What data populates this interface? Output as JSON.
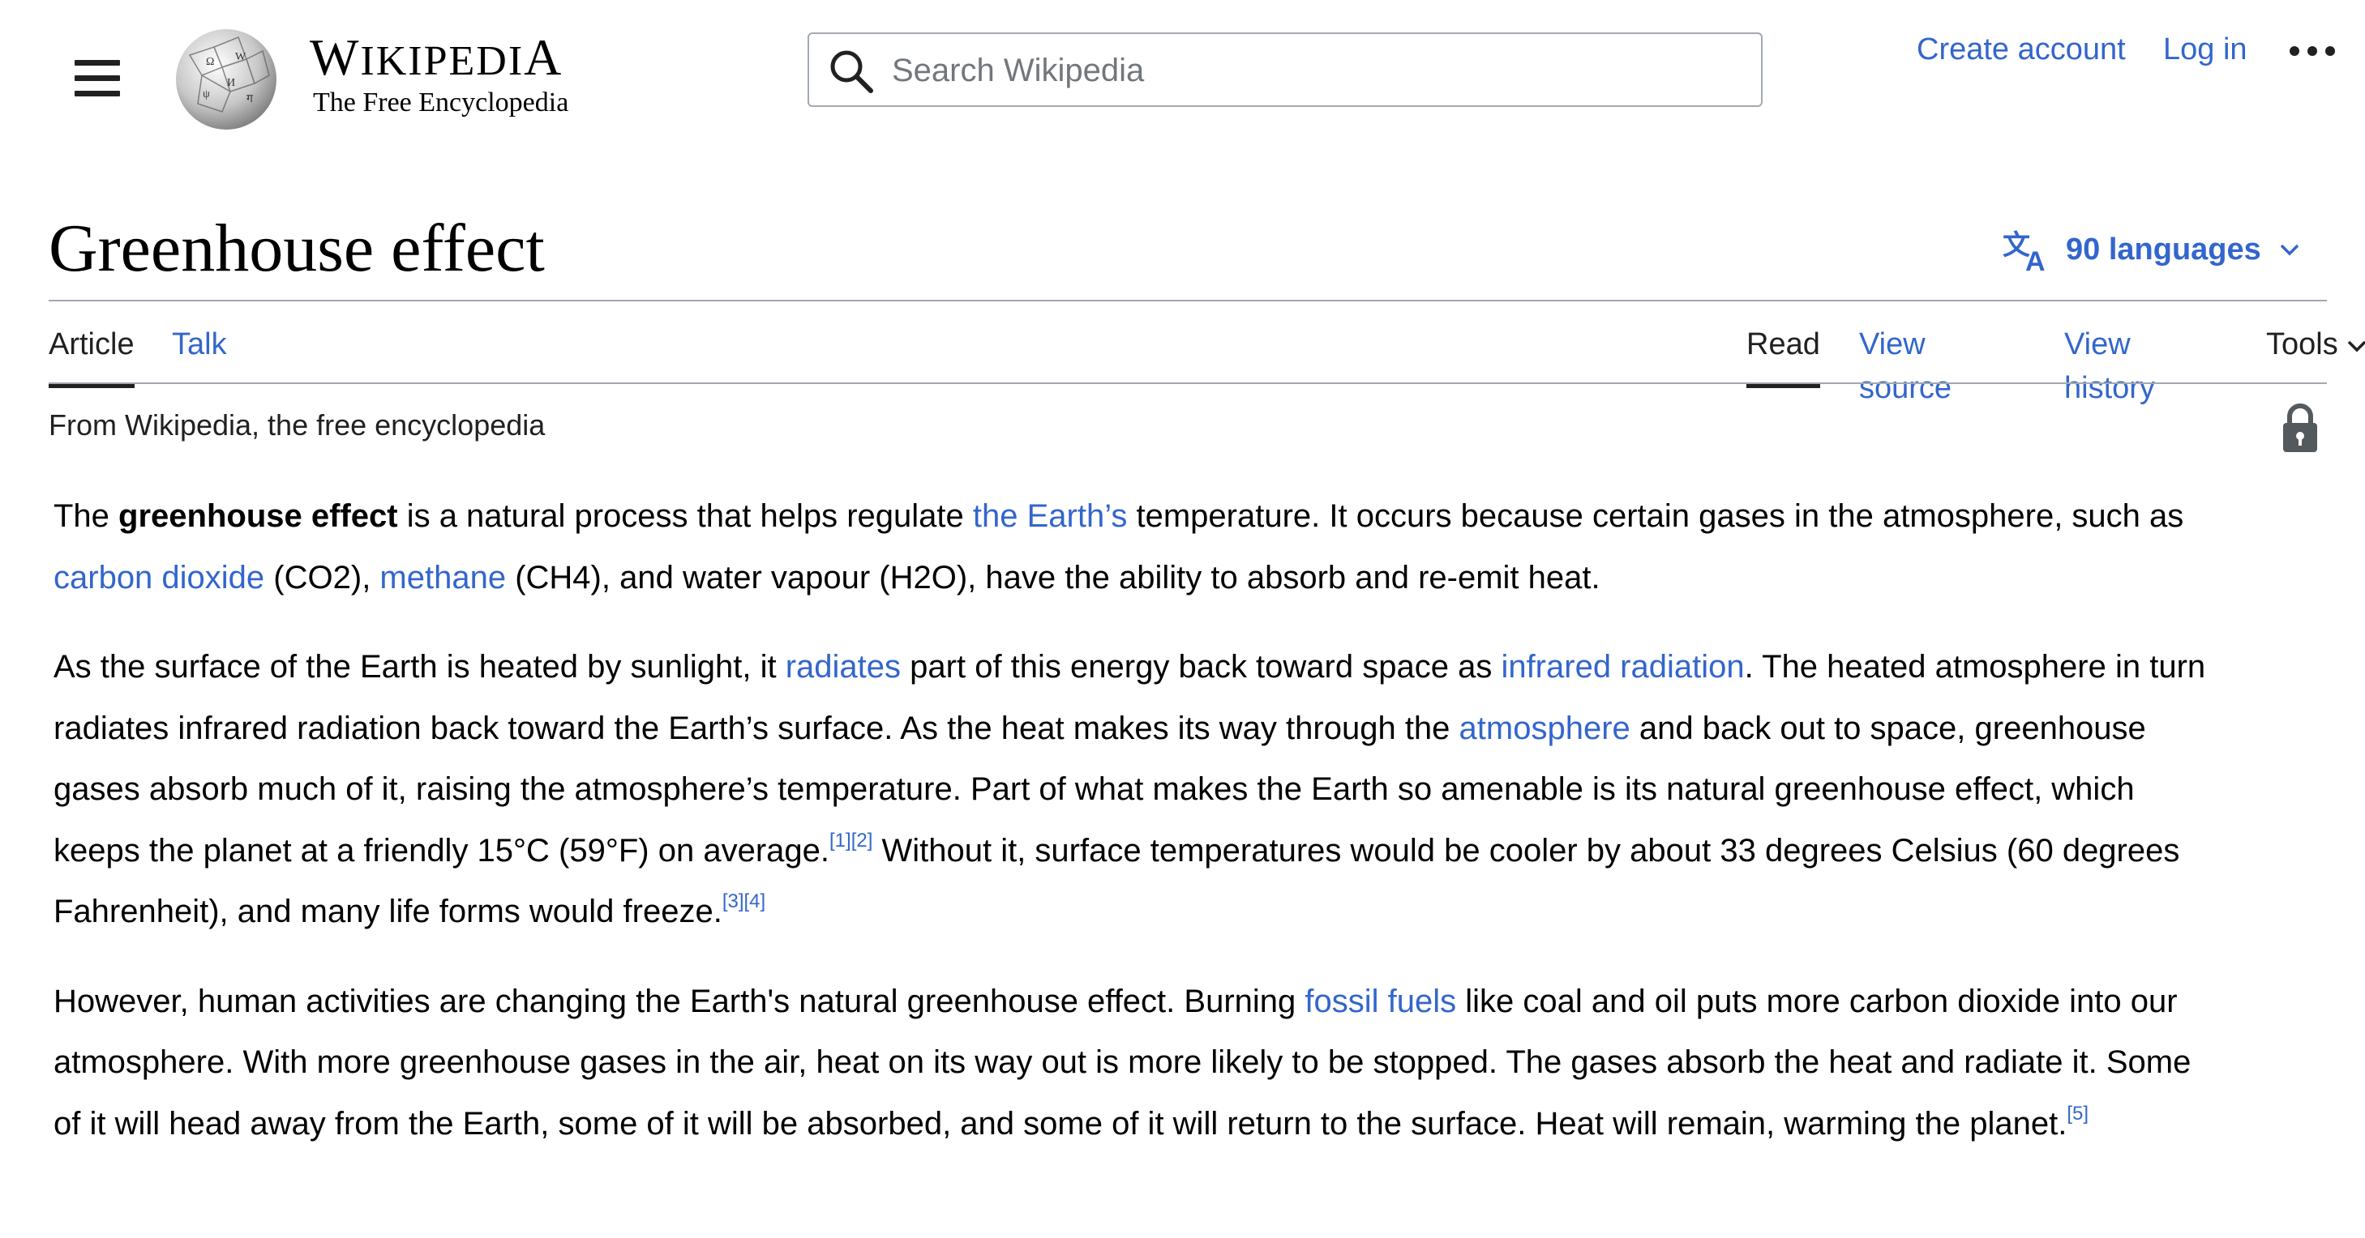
{
  "header": {
    "wordmark_first": "W",
    "wordmark_rest": "IKIPEDI",
    "wordmark_last": "A",
    "tagline": "The Free Encyclopedia",
    "search_placeholder": "Search Wikipedia",
    "create_account": "Create account",
    "log_in": "Log in"
  },
  "icons": {
    "menu": "hamburger-icon",
    "search": "search-icon",
    "more": "ellipsis-icon",
    "language": "translate-icon",
    "lock": "lock-icon"
  },
  "colors": {
    "link": "#3366cc",
    "text": "#202122",
    "border": "#a2a9b1"
  },
  "page": {
    "title": "Greenhouse effect",
    "languages": "90 languages",
    "site_sub": "From Wikipedia, the free encyclopedia"
  },
  "tabs": {
    "article": "Article",
    "talk": "Talk",
    "read": "Read",
    "view_source": "View source",
    "view_history": "View history",
    "tools": "Tools"
  },
  "article": {
    "p1": {
      "t1": "The ",
      "bold": "greenhouse effect",
      "t2": " is a natural process that helps regulate ",
      "link1": "the Earth’s",
      "t3": " temperature. It occurs because certain gases in the atmosphere, such as ",
      "link2": "carbon dioxide",
      "t4": " (CO2), ",
      "link3": "methane",
      "t5": " (CH4), and water vapour (H2O), have the ability to absorb and re-emit heat."
    },
    "p2": {
      "t1": "As the surface of the Earth is heated by sunlight, it ",
      "link1": "radiates",
      "t2": " part of this energy back toward space as ",
      "link2": "infrared radiation",
      "t3": ". The heated atmosphere in turn radiates infrared radiation back toward the Earth’s surface. As the heat makes its way through the ",
      "link3": "atmosphere",
      "t4": " and back out to space, greenhouse gases absorb much of it, raising the atmosphere’s temperature. Part of what makes the Earth so amenable is its natural greenhouse effect, which keeps the planet at a friendly 15°C (59°F) on average.",
      "ref1": "[1]",
      "ref2": "[2]",
      "t5": " Without it, surface temperatures would be cooler by about 33 degrees Celsius (60 degrees Fahrenheit), and many life forms would freeze.",
      "ref3": "[3]",
      "ref4": "[4]"
    },
    "p3": {
      "t1": "However, human activities are changing the Earth's natural greenhouse effect. Burning ",
      "link1": "fossil fuels",
      "t2": " like coal and oil puts more carbon dioxide into our atmosphere. With more greenhouse gases in the air, heat on its way out is more likely to be stopped. The gases absorb the heat and radiate it. Some of it will head away from the Earth, some of it will be absorbed, and some of it will return to the surface. Heat will remain, warming the planet.",
      "ref5": "[5]"
    }
  }
}
